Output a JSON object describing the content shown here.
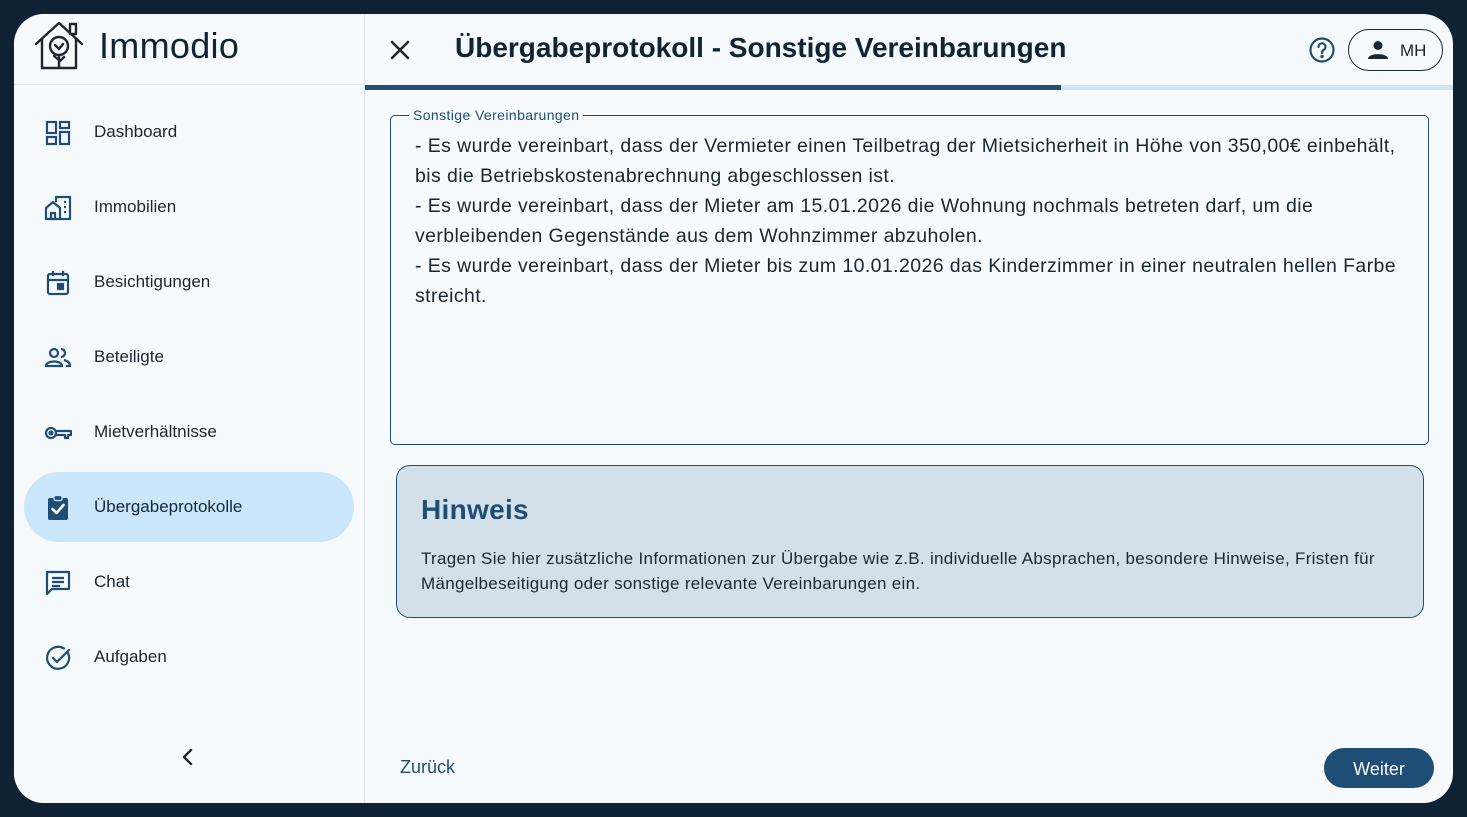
{
  "app": {
    "name": "Immodio",
    "logo_icon": "house-tree-logo"
  },
  "sidebar": {
    "items": [
      {
        "label": "Dashboard",
        "icon": "dashboard-icon",
        "active": false
      },
      {
        "label": "Immobilien",
        "icon": "buildings-icon",
        "active": false
      },
      {
        "label": "Besichtigungen",
        "icon": "calendar-icon",
        "active": false
      },
      {
        "label": "Beteiligte",
        "icon": "people-icon",
        "active": false
      },
      {
        "label": "Mietverhältnisse",
        "icon": "key-icon",
        "active": false
      },
      {
        "label": "Übergabeprotokolle",
        "icon": "clipboard-check-icon",
        "active": true
      },
      {
        "label": "Chat",
        "icon": "chat-icon",
        "active": false
      },
      {
        "label": "Aufgaben",
        "icon": "check-circle-icon",
        "active": false
      }
    ],
    "collapse_icon": "chevron-left-icon"
  },
  "header": {
    "title": "Übergabeprotokoll - Sonstige Vereinbarungen",
    "user_initials": "MH",
    "progress": 0.64
  },
  "form": {
    "field_label": "Sonstige Vereinbarungen",
    "field_value": "- Es wurde vereinbart, dass der Vermieter einen Teilbetrag der Mietsicherheit in Höhe von 350,00€ einbehält, bis die Betriebskostenabrechnung abgeschlossen ist.\n- Es wurde vereinbart, dass der Mieter am 15.01.2026 die Wohnung nochmals betreten darf, um die verbleibenden Gegenstände aus dem Wohnzimmer abzuholen.\n- Es wurde vereinbart, dass der Mieter bis zum 10.01.2026 das Kinderzimmer in einer neutralen hellen Farbe streicht."
  },
  "hint": {
    "title": "Hinweis",
    "text": "Tragen Sie hier zusätzliche Informationen zur Übergabe wie z.B. individuelle Absprachen, besondere Hinweise, Fristen für Mängelbeseitigung oder sonstige relevante Vereinbarungen ein."
  },
  "footer": {
    "back_label": "Zurück",
    "next_label": "Weiter"
  },
  "colors": {
    "primary": "#1e4e75",
    "active_nav": "#c9e6fb",
    "hint_bg": "#d3e0ea",
    "frame_bg": "#0e2233"
  }
}
